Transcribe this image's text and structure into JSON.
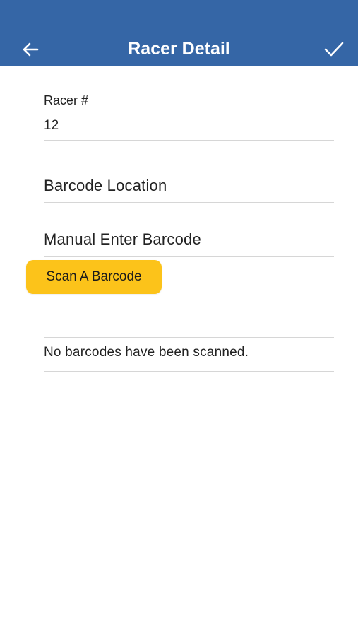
{
  "header": {
    "title": "Racer Detail",
    "background_color": "#3566A6",
    "back_icon": "arrow-left-icon",
    "confirm_icon": "check-icon"
  },
  "form": {
    "racer_number_label": "Racer #",
    "racer_number_value": "12",
    "barcode_location_placeholder": "Barcode Location",
    "manual_barcode_placeholder": "Manual Enter Barcode"
  },
  "scan_button": {
    "label": "Scan A Barcode",
    "color": "#FCC31A"
  },
  "barcode_list": {
    "empty_message": "No barcodes have been scanned."
  }
}
